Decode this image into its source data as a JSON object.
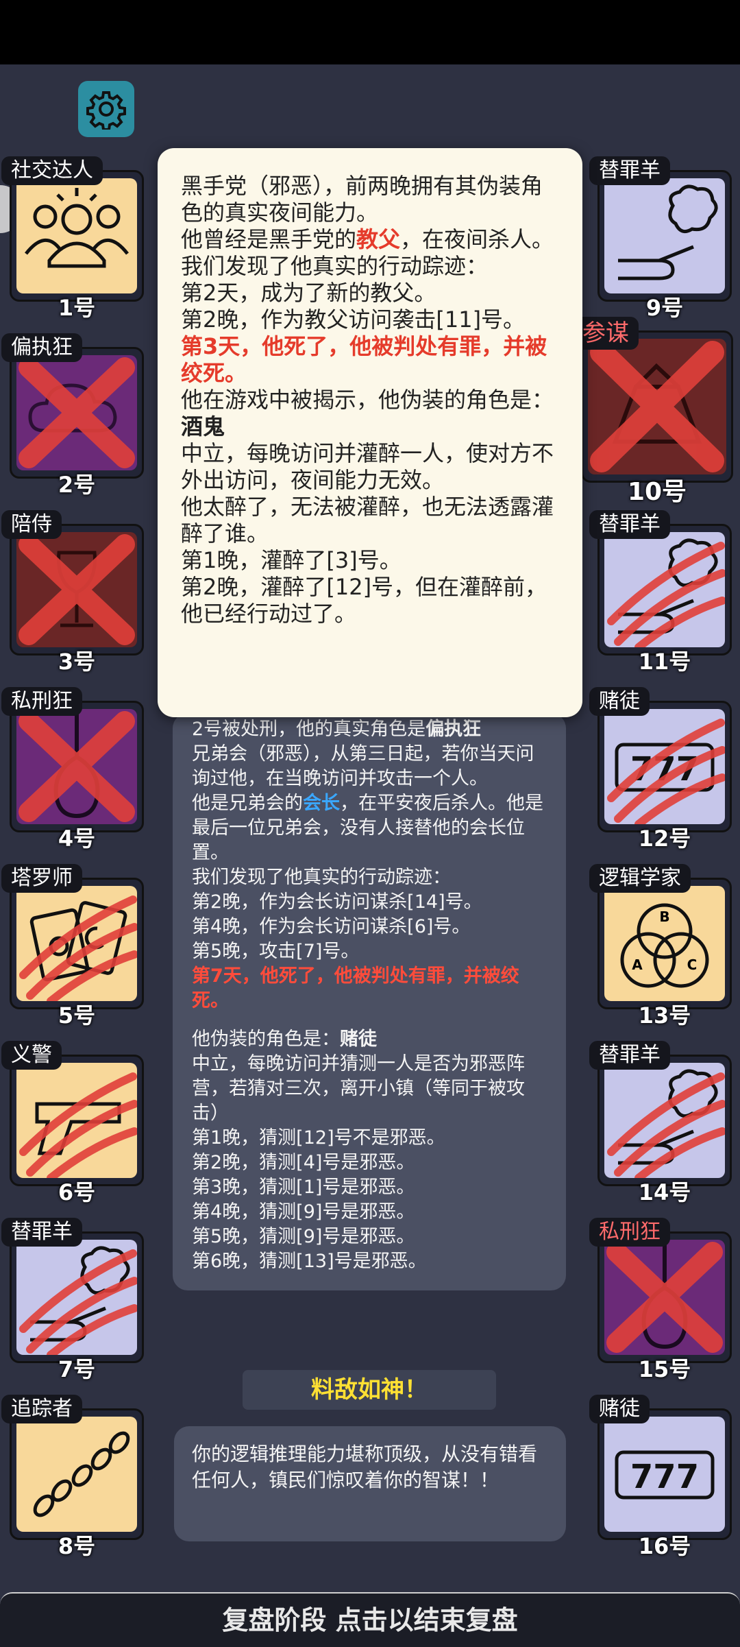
{
  "settings_icon": "gear-icon",
  "players": [
    {
      "id": "p1",
      "role": "社交达人",
      "num": "1号",
      "bg": "yellow",
      "icon": "crowd-icon",
      "mark": "none"
    },
    {
      "id": "p2",
      "role": "偏执狂",
      "num": "2号",
      "bg": "purple",
      "icon": "cloud-icon",
      "mark": "x"
    },
    {
      "id": "p3",
      "role": "陪侍",
      "num": "3号",
      "bg": "red",
      "icon": "wine-glass-icon",
      "mark": "x"
    },
    {
      "id": "p4",
      "role": "私刑狂",
      "num": "4号",
      "bg": "purple",
      "icon": "noose-icon",
      "mark": "x"
    },
    {
      "id": "p5",
      "role": "塔罗师",
      "num": "5号",
      "bg": "yellow",
      "icon": "tarot-cards-icon",
      "mark": "claw"
    },
    {
      "id": "p6",
      "role": "义警",
      "num": "6号",
      "bg": "yellow",
      "icon": "pistol-icon",
      "mark": "claw"
    },
    {
      "id": "p7",
      "role": "替罪羊",
      "num": "7号",
      "bg": "lav",
      "icon": "scapegoat-sheep-icon",
      "mark": "claw"
    },
    {
      "id": "p8",
      "role": "追踪者",
      "num": "8号",
      "bg": "yellow",
      "icon": "footprints-icon",
      "mark": "none"
    },
    {
      "id": "p9",
      "role": "替罪羊",
      "num": "9号",
      "bg": "lav",
      "icon": "scapegoat-sheep-icon",
      "mark": "none"
    },
    {
      "id": "p10",
      "role": "参谋",
      "num": "10号",
      "bg": "red",
      "icon": "strategist-icon",
      "mark": "x"
    },
    {
      "id": "p11",
      "role": "替罪羊",
      "num": "11号",
      "bg": "lav",
      "icon": "scapegoat-sheep-icon",
      "mark": "claw"
    },
    {
      "id": "p12",
      "role": "赌徒",
      "num": "12号",
      "bg": "lav",
      "icon": "slot-777-icon",
      "mark": "claw"
    },
    {
      "id": "p13",
      "role": "逻辑学家",
      "num": "13号",
      "bg": "yellow",
      "icon": "venn-diagram-icon",
      "mark": "none"
    },
    {
      "id": "p14",
      "role": "替罪羊",
      "num": "14号",
      "bg": "lav",
      "icon": "scapegoat-sheep-icon",
      "mark": "claw"
    },
    {
      "id": "p15",
      "role": "私刑狂",
      "num": "15号",
      "bg": "purple",
      "icon": "noose-icon",
      "mark": "x"
    },
    {
      "id": "p16",
      "role": "赌徒",
      "num": "16号",
      "bg": "lav",
      "icon": "slot-777-icon",
      "mark": "none"
    }
  ],
  "popup": {
    "l1": "黑手党（邪恶），前两晚拥有其伪装角色的真实夜间能力。",
    "l2a": "他曾经是黑手党的",
    "l2b": "教父",
    "l2c": "，在夜间杀人。",
    "l3": "我们发现了他真实的行动踪迹：",
    "l4": "第2天，成为了新的教父。",
    "l5": "第2晚，作为教父访问袭击[11]号。",
    "l6": "第3天，他死了，他被判处有罪，并被绞死。",
    "l7a": "他在游戏中被揭示，他伪装的角色是：",
    "l7b": "酒鬼",
    "l8": "中立，每晚访问并灌醉一人，使对方不外出访问，夜间能力无效。",
    "l9": "他太醉了，无法被灌醉，也无法透露灌醉了谁。",
    "l10": "第1晚，灌醉了[3]号。",
    "l11": "第2晚，灌醉了[12]号，但在灌醉前，他已经行动过了。"
  },
  "panel": {
    "l1a": "2号被处刑，他的真实角色是",
    "l1b": "偏执狂",
    "l2": "兄弟会（邪恶），从第三日起，若你当天问询过他，在当晚访问并攻击一个人。",
    "l3a": "他是兄弟会的",
    "l3b": "会长",
    "l3c": "，在平安夜后杀人。他是最后一位兄弟会，没有人接替他的会长位置。",
    "l4": "我们发现了他真实的行动踪迹：",
    "l5": "第2晚，作为会长访问谋杀[14]号。",
    "l6": "第4晚，作为会长访问谋杀[6]号。",
    "l7": "第5晚，攻击[7]号。",
    "l8": "第7天，他死了，他被判处有罪，并被绞死。",
    "l9a": "他伪装的角色是：",
    "l9b": "赌徒",
    "l10": "中立，每晚访问并猜测一人是否为邪恶阵营，若猜对三次，离开小镇（等同于被攻击）",
    "l11": "第1晚，猜测[12]号不是邪恶。",
    "l12": "第2晚，猜测[4]号是邪恶。",
    "l13": "第3晚，猜测[1]号是邪恶。",
    "l14": "第4晚，猜测[9]号是邪恶。",
    "l15": "第5晚，猜测[9]号是邪恶。",
    "l16": "第6晚，猜测[13]号是邪恶。"
  },
  "banner": "料敌如神！",
  "praise": "你的逻辑推理能力堪称顶级，从没有错看任何人，镇民们惊叹着你的智谋！！",
  "bottom": "复盘阶段 点击以结束复盘"
}
